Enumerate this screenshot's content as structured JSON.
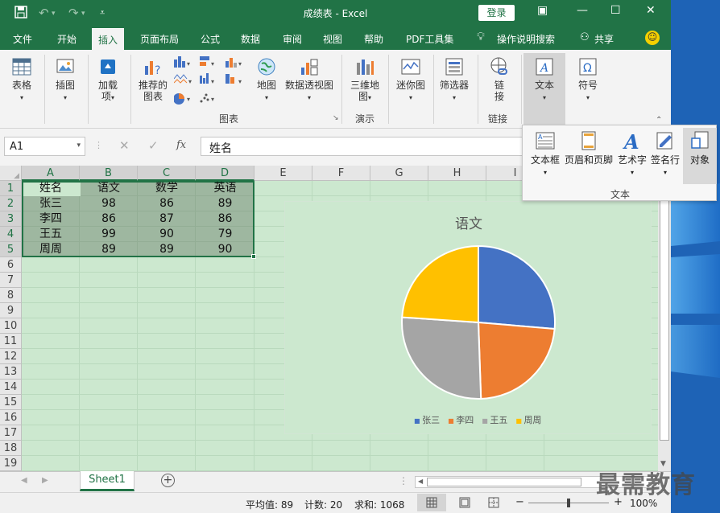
{
  "window": {
    "title": "成绩表 - Excel",
    "login": "登录"
  },
  "tabs": [
    "文件",
    "开始",
    "插入",
    "页面布局",
    "公式",
    "数据",
    "审阅",
    "视图",
    "帮助",
    "PDF工具集"
  ],
  "active_tab": "插入",
  "tellme": "操作说明搜索",
  "share": "共享",
  "ribbon": {
    "table": "表格",
    "illus": "插图",
    "addin_l1": "加载",
    "addin_l2": "项",
    "rec_l1": "推荐的",
    "rec_l2": "图表",
    "map": "地图",
    "pivot": "数据透视图",
    "charts_group": "图表",
    "map3d_l1": "三维地",
    "map3d_l2": "图",
    "tour_group": "演示",
    "sparkline": "迷你图",
    "filter": "筛选器",
    "link_l1": "链",
    "link_l2": "接",
    "link_group": "链接",
    "text": "文本",
    "symbol": "符号"
  },
  "popup": {
    "textbox": "文本框",
    "header_footer": "页眉和页脚",
    "wordart": "艺术字",
    "signature": "签名行",
    "object": "对象",
    "group": "文本"
  },
  "formula": {
    "cell": "A1",
    "fx": "fx",
    "content": "姓名"
  },
  "columns": [
    "A",
    "B",
    "C",
    "D",
    "E",
    "F",
    "G",
    "H",
    "I"
  ],
  "rows": [
    "1",
    "2",
    "3",
    "4",
    "5",
    "6",
    "7",
    "8",
    "9",
    "10",
    "11",
    "12",
    "13",
    "14",
    "15",
    "16",
    "17",
    "18",
    "19"
  ],
  "table": [
    [
      "姓名",
      "语文",
      "数学",
      "英语"
    ],
    [
      "张三",
      "98",
      "86",
      "89"
    ],
    [
      "李四",
      "86",
      "87",
      "86"
    ],
    [
      "王五",
      "99",
      "90",
      "79"
    ],
    [
      "周周",
      "89",
      "89",
      "90"
    ]
  ],
  "chart_data": {
    "type": "pie",
    "title": "语文",
    "categories": [
      "张三",
      "李四",
      "王五",
      "周周"
    ],
    "values": [
      98,
      86,
      99,
      89
    ],
    "colors": [
      "#4472c4",
      "#ed7d31",
      "#a5a5a5",
      "#ffc000"
    ],
    "legend": "bottom"
  },
  "sheet": {
    "tab": "Sheet1"
  },
  "status": {
    "avg": "平均值: 89",
    "count": "计数: 20",
    "sum": "求和: 1068",
    "zoom": "100%"
  },
  "watermark": "最需教育"
}
